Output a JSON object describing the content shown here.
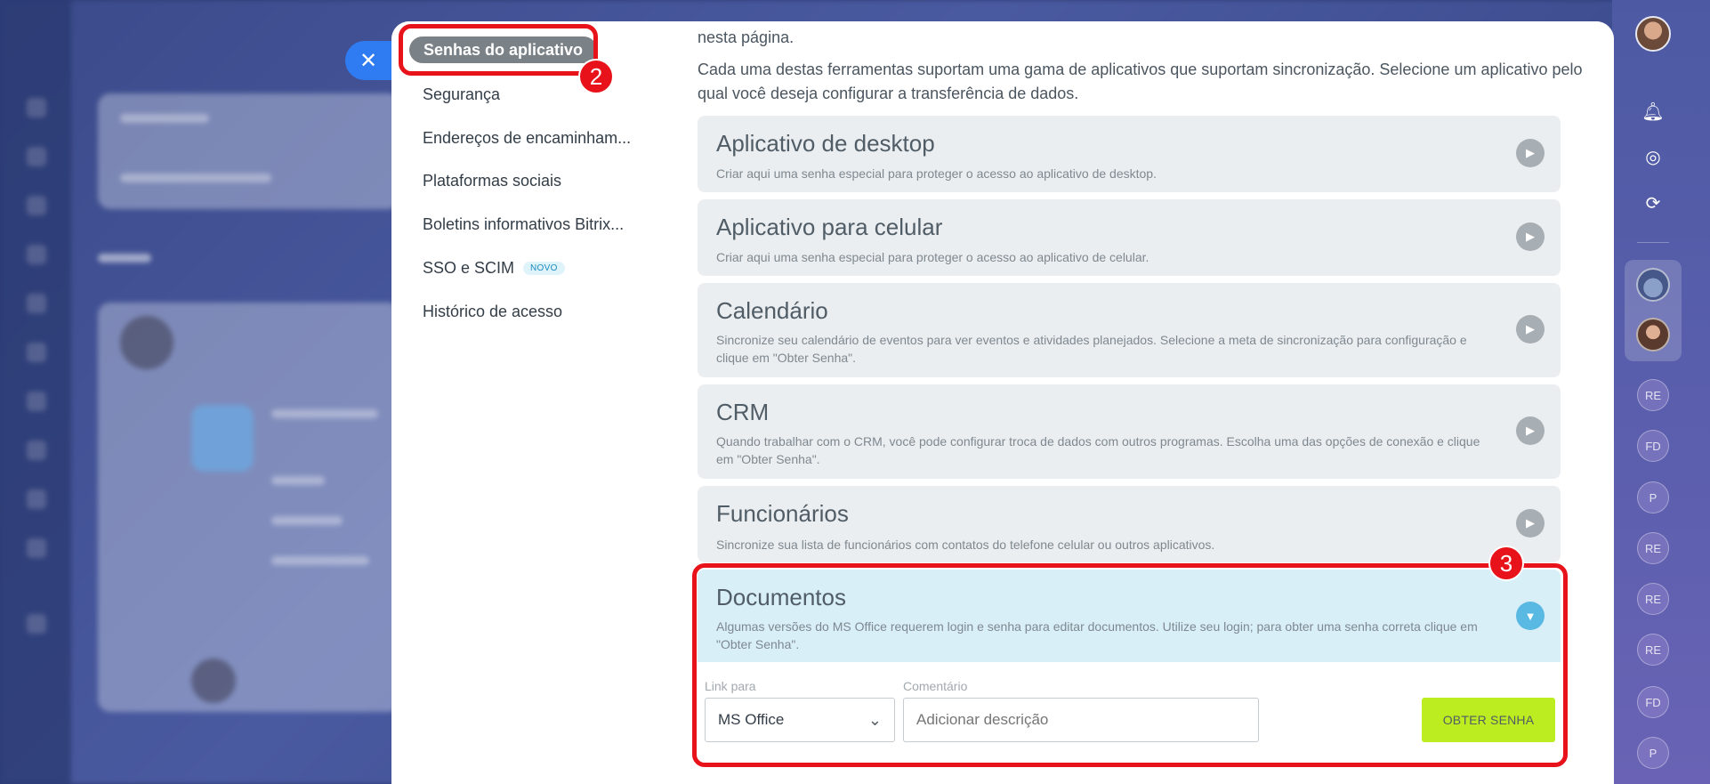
{
  "sidebar": {
    "active_item": "Senhas do aplicativo",
    "items": [
      {
        "label": "Segurança"
      },
      {
        "label": "Endereços de encaminham..."
      },
      {
        "label": "Plataformas sociais"
      },
      {
        "label": "Boletins informativos Bitrix..."
      },
      {
        "label": "SSO e SCIM",
        "badge": "NOVO"
      },
      {
        "label": "Histórico de acesso"
      }
    ]
  },
  "content": {
    "intro_top": "nesta página.",
    "intro_text": "Cada uma destas ferramentas suportam uma gama de aplicativos que suportam sincronização. Selecione um aplicativo pelo qual você deseja configurar a transferência de dados.",
    "cards": [
      {
        "title": "Aplicativo de desktop",
        "description": "Criar aqui uma senha especial para proteger o acesso ao aplicativo de desktop."
      },
      {
        "title": "Aplicativo para celular",
        "description": "Criar aqui uma senha especial para proteger o acesso ao aplicativo de celular."
      },
      {
        "title": "Calendário",
        "description": "Sincronize seu calendário de eventos para ver eventos e atividades planejados. Selecione a meta de sincronização para configuração e clique em \"Obter Senha\"."
      },
      {
        "title": "CRM",
        "description": "Quando trabalhar com o CRM, você pode configurar troca de dados com outros programas. Escolha uma das opções de conexão e clique em \"Obter Senha\"."
      },
      {
        "title": "Funcionários",
        "description": "Sincronize sua lista de funcionários com contatos do telefone celular ou outros aplicativos."
      },
      {
        "title": "Documentos",
        "description": "Algumas versões do MS Office requerem login e senha para editar documentos. Utilize seu login; para obter uma senha correta clique em \"Obter Senha\"."
      }
    ],
    "form": {
      "link_label": "Link para",
      "link_value": "MS Office",
      "comment_label": "Comentário",
      "comment_placeholder": "Adicionar descrição",
      "button_label": "OBTER SENHA"
    }
  },
  "right_bar": {
    "avatars": [
      "RE",
      "FD",
      "P",
      "RE",
      "RE",
      "RE",
      "FD",
      "P"
    ]
  },
  "annotations": {
    "step2": "2",
    "step3": "3"
  },
  "colors": {
    "accent": "#2f7bf2",
    "annotation": "#e8121a",
    "button": "#bbed21",
    "open_card": "#d8eff8"
  }
}
